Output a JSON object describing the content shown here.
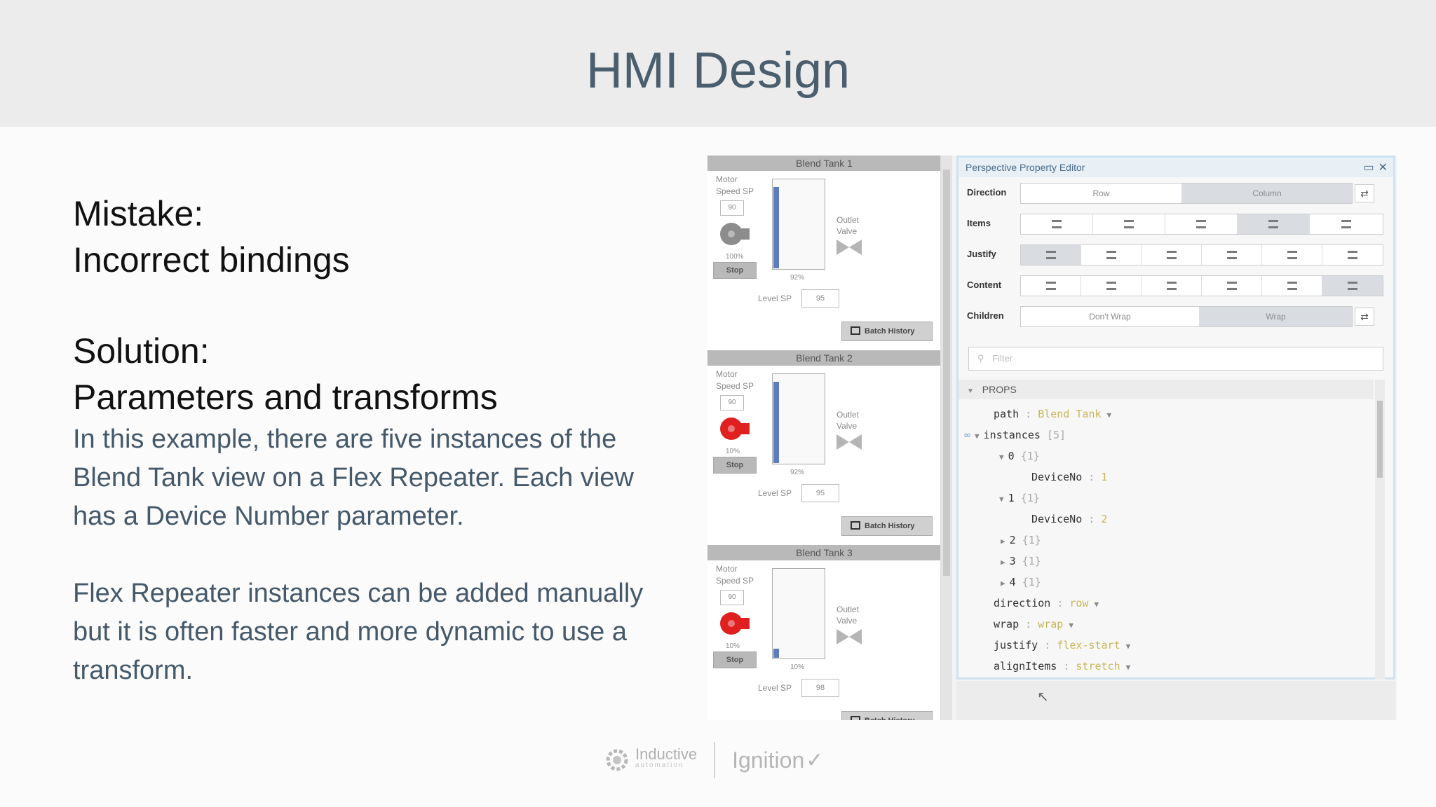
{
  "slide": {
    "title": "HMI Design",
    "mistake_heading": "Mistake:",
    "mistake_text": "Incorrect bindings",
    "solution_heading": "Solution:",
    "solution_text": "Parameters and transforms",
    "paragraph1_line1": "In this example, there are five instances of the",
    "paragraph1_line2": "Blend Tank view on a Flex Repeater. Each view",
    "paragraph1_line3": "has a Device Number parameter.",
    "paragraph2_line1": "Flex Repeater instances can be added manually",
    "paragraph2_line2": "but it is often faster and more dynamic to use a",
    "paragraph2_line3": "transform."
  },
  "tanks": [
    {
      "title": "Blend Tank 1",
      "motor_label_1": "Motor",
      "motor_label_2": "Speed SP",
      "speed_sp": "90",
      "motor_speed": "100%",
      "stop_label": "Stop",
      "level_pct": "92%",
      "level_fraction": 0.92,
      "outlet_label_1": "Outlet",
      "outlet_label_2": "Valve",
      "level_sp_label": "Level SP",
      "level_sp": "95",
      "batch_label": "Batch History",
      "motor_color": "#8c8c8c"
    },
    {
      "title": "Blend Tank 2",
      "motor_label_1": "Motor",
      "motor_label_2": "Speed SP",
      "speed_sp": "90",
      "motor_speed": "10%",
      "stop_label": "Stop",
      "level_pct": "92%",
      "level_fraction": 0.92,
      "outlet_label_1": "Outlet",
      "outlet_label_2": "Valve",
      "level_sp_label": "Level SP",
      "level_sp": "95",
      "batch_label": "Batch History",
      "motor_color": "#e02020"
    },
    {
      "title": "Blend Tank 3",
      "motor_label_1": "Motor",
      "motor_label_2": "Speed SP",
      "speed_sp": "90",
      "motor_speed": "10%",
      "stop_label": "Stop",
      "level_pct": "10%",
      "level_fraction": 0.1,
      "outlet_label_1": "Outlet",
      "outlet_label_2": "Valve",
      "level_sp_label": "Level SP",
      "level_sp": "98",
      "batch_label": "Batch History",
      "motor_color": "#e02020"
    }
  ],
  "editor": {
    "title": "Perspective Property Editor",
    "rows": {
      "direction": {
        "label": "Direction",
        "row_option": "Row",
        "column_option": "Column"
      },
      "items": {
        "label": "Items"
      },
      "justify": {
        "label": "Justify"
      },
      "content": {
        "label": "Content"
      },
      "children": {
        "label": "Children",
        "nowrap_option": "Don't Wrap",
        "wrap_option": "Wrap"
      }
    },
    "filter_placeholder": "Filter",
    "props_label": "PROPS",
    "tree": [
      {
        "key": "path",
        "value": "Blend Tank"
      },
      {
        "key": "instances",
        "value": "[5]"
      },
      {
        "key": "0",
        "value": "{1}"
      },
      {
        "key": "DeviceNo",
        "value": "1"
      },
      {
        "key": "1",
        "value": "{1}"
      },
      {
        "key": "DeviceNo",
        "value": "2"
      },
      {
        "key": "2",
        "value": "{1}"
      },
      {
        "key": "3",
        "value": "{1}"
      },
      {
        "key": "4",
        "value": "{1}"
      },
      {
        "key": "direction",
        "value": "row"
      },
      {
        "key": "wrap",
        "value": "wrap"
      },
      {
        "key": "justify",
        "value": "flex-start"
      },
      {
        "key": "alignItems",
        "value": "stretch"
      }
    ]
  },
  "footer": {
    "brand_1": "Inductive",
    "brand_1_sub": "automation",
    "brand_2": "Ignition"
  },
  "colors": {
    "title": "#4a5e6d",
    "body_text": "#45596a",
    "tank_fill": "#5b7cc0",
    "value_text": "#c8b65a"
  }
}
